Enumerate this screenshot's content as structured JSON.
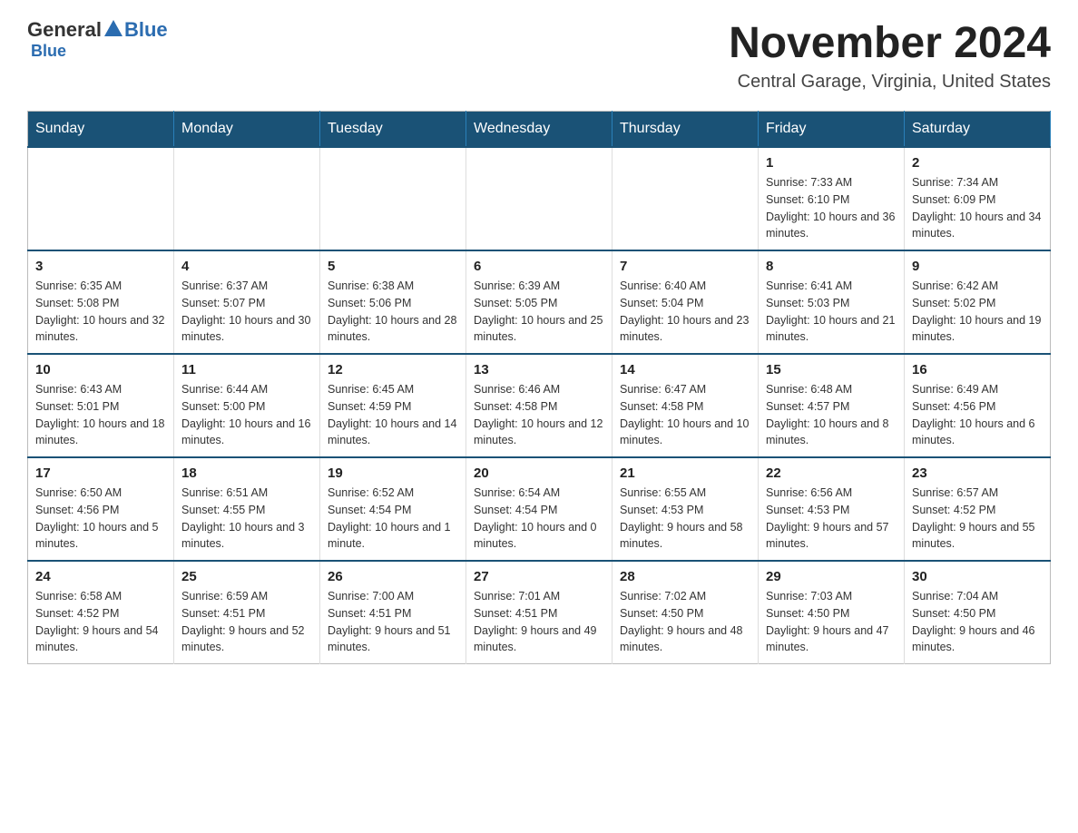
{
  "logo": {
    "general": "General",
    "blue": "Blue",
    "triangle_color": "#2b6cb0"
  },
  "header": {
    "title": "November 2024",
    "subtitle": "Central Garage, Virginia, United States"
  },
  "days_of_week": [
    "Sunday",
    "Monday",
    "Tuesday",
    "Wednesday",
    "Thursday",
    "Friday",
    "Saturday"
  ],
  "weeks": [
    [
      {
        "day": "",
        "info": ""
      },
      {
        "day": "",
        "info": ""
      },
      {
        "day": "",
        "info": ""
      },
      {
        "day": "",
        "info": ""
      },
      {
        "day": "",
        "info": ""
      },
      {
        "day": "1",
        "info": "Sunrise: 7:33 AM\nSunset: 6:10 PM\nDaylight: 10 hours and 36 minutes."
      },
      {
        "day": "2",
        "info": "Sunrise: 7:34 AM\nSunset: 6:09 PM\nDaylight: 10 hours and 34 minutes."
      }
    ],
    [
      {
        "day": "3",
        "info": "Sunrise: 6:35 AM\nSunset: 5:08 PM\nDaylight: 10 hours and 32 minutes."
      },
      {
        "day": "4",
        "info": "Sunrise: 6:37 AM\nSunset: 5:07 PM\nDaylight: 10 hours and 30 minutes."
      },
      {
        "day": "5",
        "info": "Sunrise: 6:38 AM\nSunset: 5:06 PM\nDaylight: 10 hours and 28 minutes."
      },
      {
        "day": "6",
        "info": "Sunrise: 6:39 AM\nSunset: 5:05 PM\nDaylight: 10 hours and 25 minutes."
      },
      {
        "day": "7",
        "info": "Sunrise: 6:40 AM\nSunset: 5:04 PM\nDaylight: 10 hours and 23 minutes."
      },
      {
        "day": "8",
        "info": "Sunrise: 6:41 AM\nSunset: 5:03 PM\nDaylight: 10 hours and 21 minutes."
      },
      {
        "day": "9",
        "info": "Sunrise: 6:42 AM\nSunset: 5:02 PM\nDaylight: 10 hours and 19 minutes."
      }
    ],
    [
      {
        "day": "10",
        "info": "Sunrise: 6:43 AM\nSunset: 5:01 PM\nDaylight: 10 hours and 18 minutes."
      },
      {
        "day": "11",
        "info": "Sunrise: 6:44 AM\nSunset: 5:00 PM\nDaylight: 10 hours and 16 minutes."
      },
      {
        "day": "12",
        "info": "Sunrise: 6:45 AM\nSunset: 4:59 PM\nDaylight: 10 hours and 14 minutes."
      },
      {
        "day": "13",
        "info": "Sunrise: 6:46 AM\nSunset: 4:58 PM\nDaylight: 10 hours and 12 minutes."
      },
      {
        "day": "14",
        "info": "Sunrise: 6:47 AM\nSunset: 4:58 PM\nDaylight: 10 hours and 10 minutes."
      },
      {
        "day": "15",
        "info": "Sunrise: 6:48 AM\nSunset: 4:57 PM\nDaylight: 10 hours and 8 minutes."
      },
      {
        "day": "16",
        "info": "Sunrise: 6:49 AM\nSunset: 4:56 PM\nDaylight: 10 hours and 6 minutes."
      }
    ],
    [
      {
        "day": "17",
        "info": "Sunrise: 6:50 AM\nSunset: 4:56 PM\nDaylight: 10 hours and 5 minutes."
      },
      {
        "day": "18",
        "info": "Sunrise: 6:51 AM\nSunset: 4:55 PM\nDaylight: 10 hours and 3 minutes."
      },
      {
        "day": "19",
        "info": "Sunrise: 6:52 AM\nSunset: 4:54 PM\nDaylight: 10 hours and 1 minute."
      },
      {
        "day": "20",
        "info": "Sunrise: 6:54 AM\nSunset: 4:54 PM\nDaylight: 10 hours and 0 minutes."
      },
      {
        "day": "21",
        "info": "Sunrise: 6:55 AM\nSunset: 4:53 PM\nDaylight: 9 hours and 58 minutes."
      },
      {
        "day": "22",
        "info": "Sunrise: 6:56 AM\nSunset: 4:53 PM\nDaylight: 9 hours and 57 minutes."
      },
      {
        "day": "23",
        "info": "Sunrise: 6:57 AM\nSunset: 4:52 PM\nDaylight: 9 hours and 55 minutes."
      }
    ],
    [
      {
        "day": "24",
        "info": "Sunrise: 6:58 AM\nSunset: 4:52 PM\nDaylight: 9 hours and 54 minutes."
      },
      {
        "day": "25",
        "info": "Sunrise: 6:59 AM\nSunset: 4:51 PM\nDaylight: 9 hours and 52 minutes."
      },
      {
        "day": "26",
        "info": "Sunrise: 7:00 AM\nSunset: 4:51 PM\nDaylight: 9 hours and 51 minutes."
      },
      {
        "day": "27",
        "info": "Sunrise: 7:01 AM\nSunset: 4:51 PM\nDaylight: 9 hours and 49 minutes."
      },
      {
        "day": "28",
        "info": "Sunrise: 7:02 AM\nSunset: 4:50 PM\nDaylight: 9 hours and 48 minutes."
      },
      {
        "day": "29",
        "info": "Sunrise: 7:03 AM\nSunset: 4:50 PM\nDaylight: 9 hours and 47 minutes."
      },
      {
        "day": "30",
        "info": "Sunrise: 7:04 AM\nSunset: 4:50 PM\nDaylight: 9 hours and 46 minutes."
      }
    ]
  ]
}
